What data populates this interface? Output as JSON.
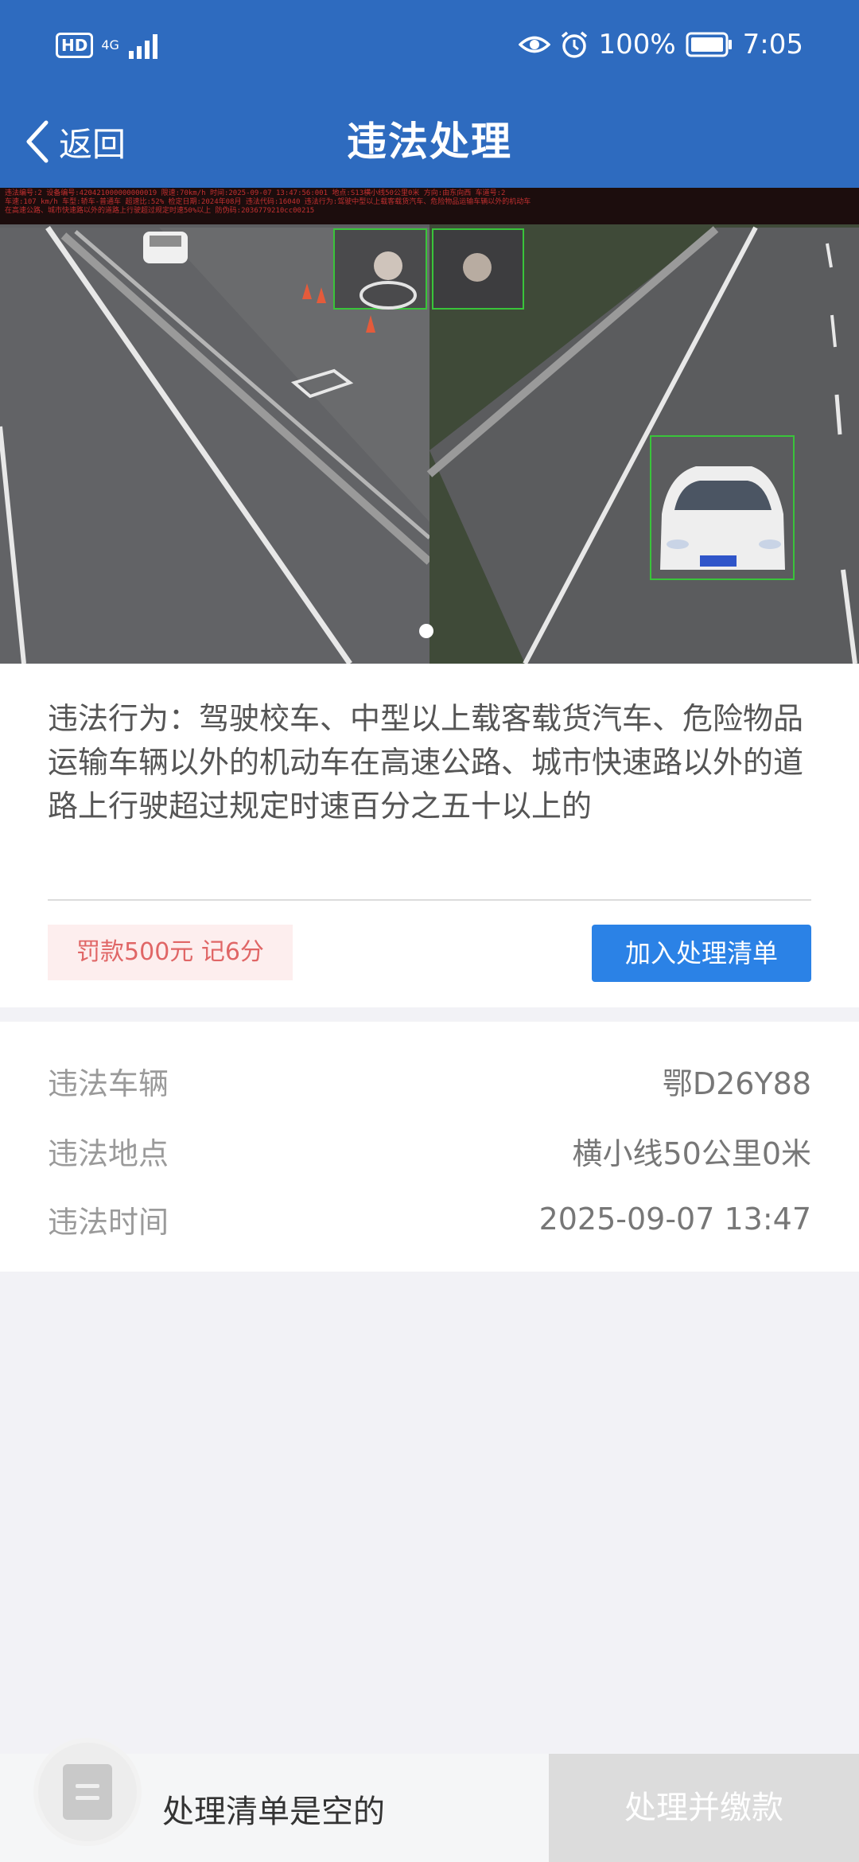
{
  "status_bar": {
    "hd": "HD",
    "network": "4G",
    "battery_percent": "100%",
    "time": "7:05",
    "icons": [
      "signal-icon",
      "eye-icon",
      "alarm-icon",
      "battery-icon"
    ]
  },
  "nav": {
    "back_label": "返回",
    "title": "违法处理"
  },
  "photo": {
    "caption_line1": "违法编号:2 设备编号:420421000000000019 限速:70km/h  时间:2025-09-07 13:47:56:001 地点:S13横小线50公里0米 方向:由东向西 车道号:2",
    "caption_line2": "车速:107 km/h 车型:轿车-普通车 超速比:52% 检定日期:2024年08月 违法代码:16040 违法行为:驾驶中型以上载客载货汽车、危险物品运输车辆以外的机动车",
    "caption_line3": "在高速公路、城市快速路以外的道路上行驶超过规定时速50%以上 防伪码:2036779210cc00215",
    "page_count": 1,
    "current_page": 1
  },
  "violation": {
    "text": "违法行为：驾驶校车、中型以上载客载货汽车、危险物品运输车辆以外的机动车在高速公路、城市快速路以外的道路上行驶超过规定时速百分之五十以上的",
    "penalty": "罚款500元 记6分",
    "add_button": "加入处理清单"
  },
  "details": [
    {
      "label": "违法车辆",
      "value": "鄂D26Y88"
    },
    {
      "label": "违法地点",
      "value": "横小线50公里0米"
    },
    {
      "label": "违法时间",
      "value": "2025-09-07 13:47"
    }
  ],
  "bottom": {
    "empty_text": "处理清单是空的",
    "pay_button": "处理并缴款"
  },
  "colors": {
    "primary": "#2e6bbf",
    "button_blue": "#2b82e6",
    "penalty_text": "#e06666",
    "penalty_bg": "#fdeeee",
    "disabled": "#dcdcdc"
  }
}
